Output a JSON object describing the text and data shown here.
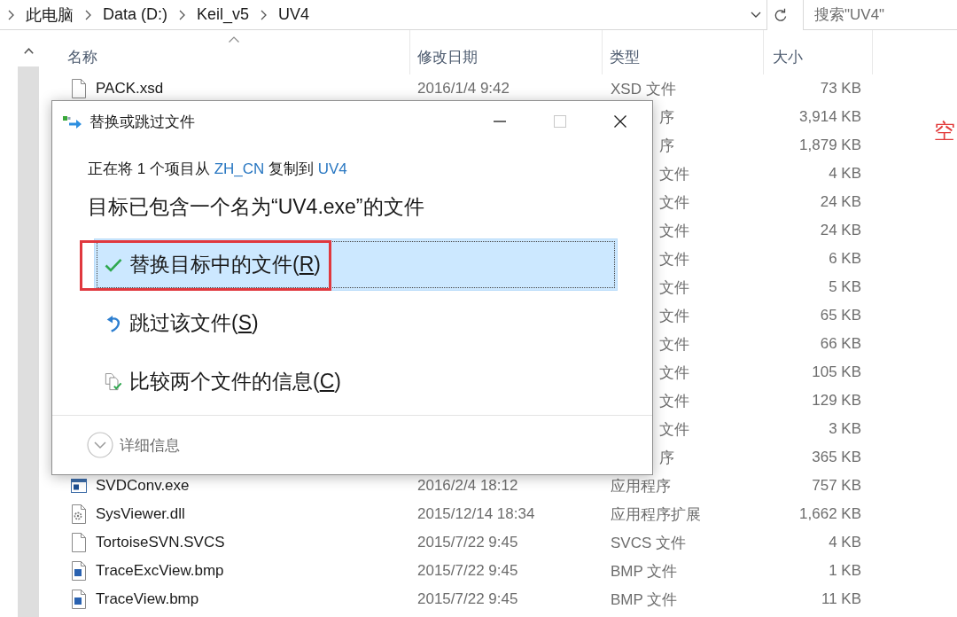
{
  "address_bar": {
    "crumbs": [
      "此电脑",
      "Data (D:)",
      "Keil_v5",
      "UV4"
    ]
  },
  "search": {
    "placeholder": "搜索\"UV4\""
  },
  "columns": [
    {
      "label": "名称",
      "sorted": true
    },
    {
      "label": "修改日期",
      "sorted": false
    },
    {
      "label": "类型",
      "sorted": false
    },
    {
      "label": "大小",
      "sorted": false
    }
  ],
  "rows": [
    {
      "kind": "plain",
      "name": "PACK.xsd",
      "date": "2016/1/4 9:42",
      "type": "XSD 文件",
      "size": "73 KB"
    },
    {
      "kind": "covered",
      "type": "序",
      "size": "3,914 KB"
    },
    {
      "kind": "covered",
      "type": "序",
      "size": "1,879 KB"
    },
    {
      "kind": "covered",
      "type": "文件",
      "size": "4 KB"
    },
    {
      "kind": "covered",
      "type": "文件",
      "size": "24 KB"
    },
    {
      "kind": "covered",
      "type": "文件",
      "size": "24 KB"
    },
    {
      "kind": "covered",
      "type": "文件",
      "size": "6 KB"
    },
    {
      "kind": "covered",
      "type": "文件",
      "size": "5 KB"
    },
    {
      "kind": "covered",
      "type": "文件",
      "size": "65 KB"
    },
    {
      "kind": "covered",
      "type": "文件",
      "size": "66 KB"
    },
    {
      "kind": "covered",
      "type": "文件",
      "size": "105 KB"
    },
    {
      "kind": "covered",
      "type": "文件",
      "size": "129 KB"
    },
    {
      "kind": "covered",
      "type": "文件",
      "size": "3 KB"
    },
    {
      "kind": "covered",
      "type": "序",
      "size": "365 KB"
    },
    {
      "kind": "program",
      "name": "SVDConv.exe",
      "date": "2016/2/4 18:12",
      "type": "应用程序",
      "size": "757 KB"
    },
    {
      "kind": "library",
      "name": "SysViewer.dll",
      "date": "2015/12/14 18:34",
      "type": "应用程序扩展",
      "size": "1,662 KB"
    },
    {
      "kind": "plain",
      "name": "TortoiseSVN.SVCS",
      "date": "2015/7/22 9:45",
      "type": "SVCS 文件",
      "size": "4 KB"
    },
    {
      "kind": "bitmap",
      "name": "TraceExcView.bmp",
      "date": "2015/7/22 9:45",
      "type": "BMP 文件",
      "size": "1 KB"
    },
    {
      "kind": "bitmap",
      "name": "TraceView.bmp",
      "date": "2015/7/22 9:45",
      "type": "BMP 文件",
      "size": "11 KB"
    }
  ],
  "dialog": {
    "title": "替换或跳过文件",
    "controls": [
      {
        "kind": "minimize",
        "disabled": false
      },
      {
        "kind": "maximize",
        "disabled": true
      },
      {
        "kind": "close",
        "disabled": false
      }
    ],
    "message": [
      {
        "kind": "text",
        "text": "正在将 1 个项目从 "
      },
      {
        "kind": "link",
        "text": "ZH_CN"
      },
      {
        "kind": "text",
        "text": " 复制到 "
      },
      {
        "kind": "link",
        "text": "UV4"
      }
    ],
    "heading": "目标已包含一个名为“UV4.exe”的文件",
    "options": [
      {
        "kind": "replace",
        "selected": true,
        "annotated": true,
        "label": [
          {
            "text": "替换目标中的文件(",
            "underlined": false
          },
          {
            "text": "R",
            "underlined": true
          },
          {
            "text": ")",
            "underlined": false
          }
        ]
      },
      {
        "kind": "skip",
        "selected": false,
        "annotated": false,
        "label": [
          {
            "text": "跳过该文件(",
            "underlined": false
          },
          {
            "text": "S",
            "underlined": true
          },
          {
            "text": ")",
            "underlined": false
          }
        ]
      },
      {
        "kind": "compare",
        "selected": false,
        "annotated": false,
        "label": [
          {
            "text": "比较两个文件的信息(",
            "underlined": false
          },
          {
            "text": "C",
            "underlined": true
          },
          {
            "text": ")",
            "underlined": false
          }
        ]
      }
    ],
    "details": {
      "label": "详细信息",
      "expanded": false
    }
  },
  "side_note": "空"
}
